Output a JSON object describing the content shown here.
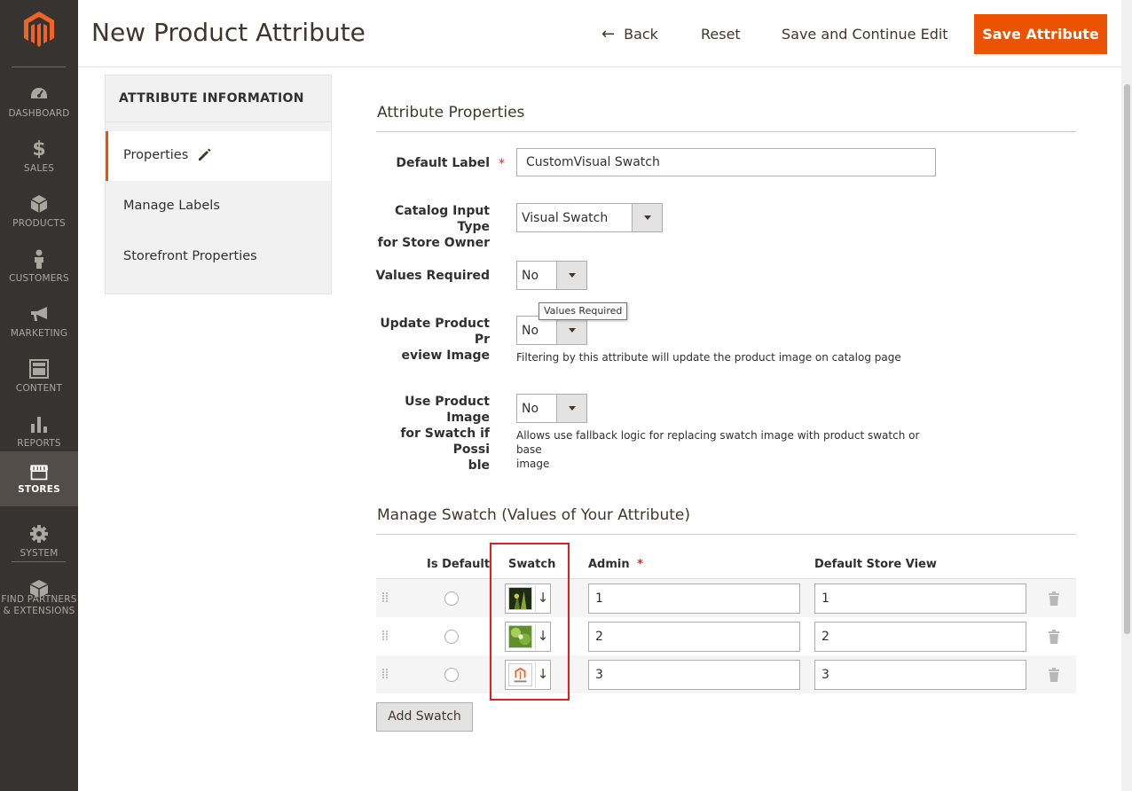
{
  "sidebar": {
    "logo": "magento-logo",
    "items": [
      {
        "label": "DASHBOARD",
        "icon": "dashboard-icon"
      },
      {
        "label": "SALES",
        "icon": "dollar-icon"
      },
      {
        "label": "PRODUCTS",
        "icon": "cube-icon"
      },
      {
        "label": "CUSTOMERS",
        "icon": "person-icon"
      },
      {
        "label": "MARKETING",
        "icon": "megaphone-icon"
      },
      {
        "label": "CONTENT",
        "icon": "content-icon"
      },
      {
        "label": "REPORTS",
        "icon": "bar-chart-icon"
      },
      {
        "label": "STORES",
        "icon": "store-icon",
        "active": true
      },
      {
        "label": "SYSTEM",
        "icon": "gear-icon"
      },
      {
        "label": "FIND PARTNERS",
        "label2": "& EXTENSIONS",
        "icon": "extensions-icon"
      }
    ]
  },
  "header": {
    "title": "New Product Attribute",
    "back_label": "Back",
    "reset_label": "Reset",
    "save_continue_label": "Save and Continue Edit",
    "save_label": "Save Attribute",
    "accent_color": "#eb5202"
  },
  "tabs": {
    "title": "ATTRIBUTE INFORMATION",
    "items": [
      "Properties",
      "Manage Labels",
      "Storefront Properties"
    ]
  },
  "properties": {
    "title": "Attribute Properties",
    "default_label": {
      "label": "Default Label",
      "value": "CustomVisual Swatch"
    },
    "input_type": {
      "label1": "Catalog Input Type",
      "label2": "for Store Owner",
      "value": "Visual Swatch"
    },
    "values_required": {
      "label": "Values Required",
      "value": "No",
      "tooltip": "Values Required"
    },
    "update_preview": {
      "label1": "Update Product Pr",
      "label2": "eview Image",
      "value": "No",
      "note": "Filtering by this attribute will update the product image on catalog page"
    },
    "use_product_image": {
      "label1": "Use Product Image",
      "label2": "for Swatch if Possi",
      "label3": "ble",
      "value": "No",
      "note1": "Allows use fallback logic for replacing swatch image with product swatch or base",
      "note2": "image"
    }
  },
  "swatches": {
    "title": "Manage Swatch (Values of Your Attribute)",
    "headers": {
      "is_default": "Is Default",
      "swatch": "Swatch",
      "admin": "Admin",
      "store_view": "Default Store View"
    },
    "rows": [
      {
        "admin": "1",
        "store": "1",
        "swatch": "dark-green-image"
      },
      {
        "admin": "2",
        "store": "2",
        "swatch": "green-leaves-image"
      },
      {
        "admin": "3",
        "store": "3",
        "swatch": "magento-logo-image"
      }
    ],
    "add_label": "Add Swatch"
  }
}
